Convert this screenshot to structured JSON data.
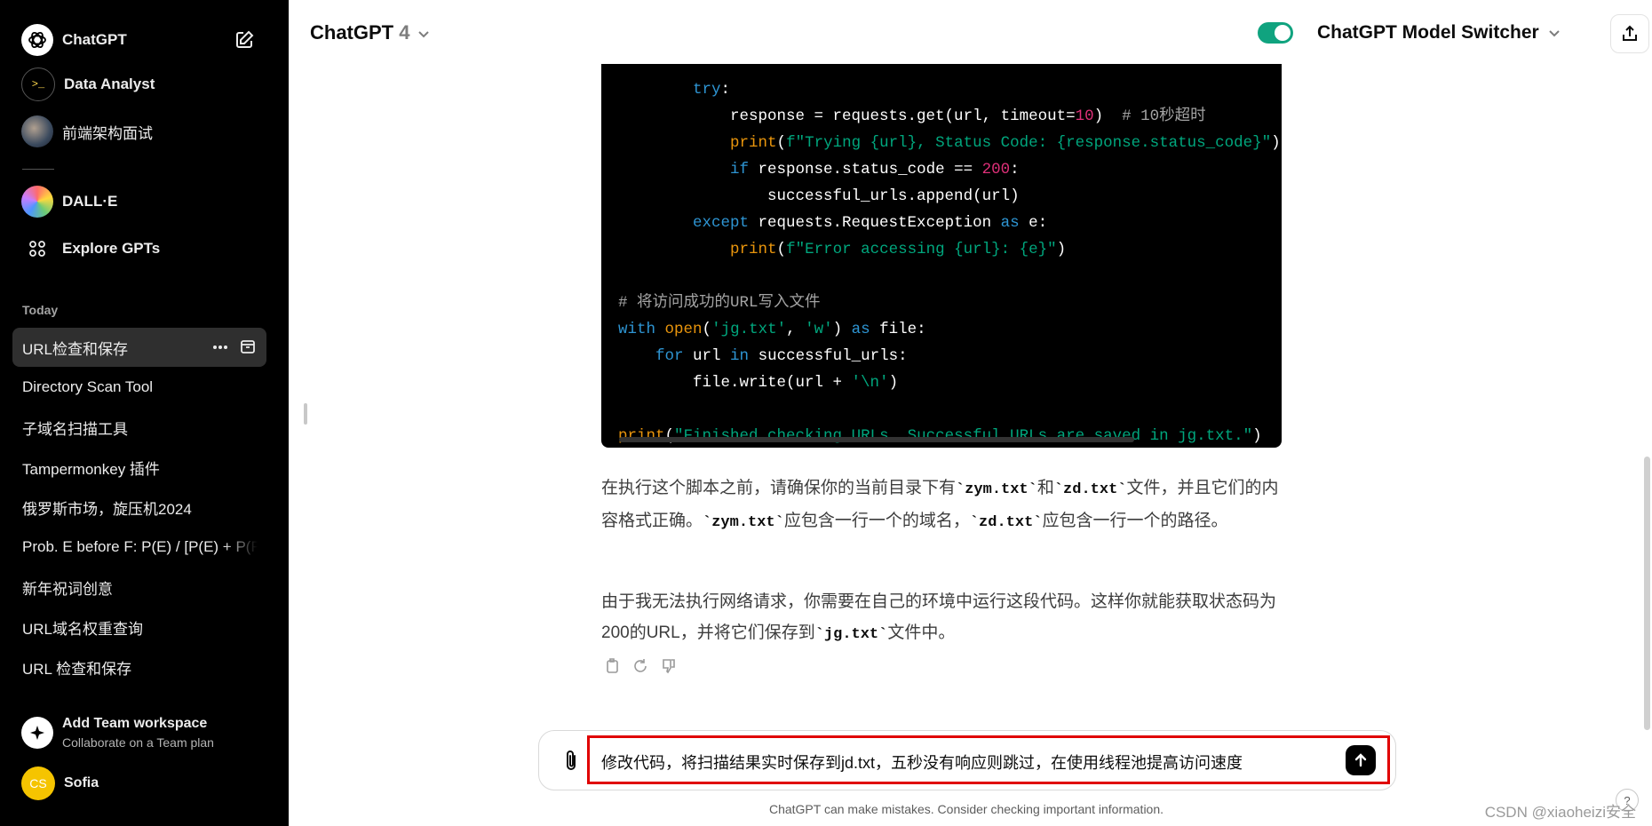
{
  "sidebar": {
    "brand": "ChatGPT",
    "gpts": [
      {
        "label": "Data Analyst"
      },
      {
        "label": "前端架构面试"
      },
      {
        "label": "DALL·E"
      },
      {
        "label": "Explore GPTs"
      }
    ],
    "section_today": "Today",
    "history": [
      "URL检查和保存",
      "Directory Scan Tool",
      "子域名扫描工具",
      "Tampermonkey 插件",
      "俄罗斯市场，旋压机2024",
      "Prob. E before F: P(E) / [P(E) + P(F)]",
      "新年祝词创意",
      "URL域名权重查询",
      "URL 检查和保存"
    ],
    "team_title": "Add Team workspace",
    "team_sub": "Collaborate on a Team plan",
    "user_initials": "CS",
    "user_name": "Sofia"
  },
  "header": {
    "model_name": "ChatGPT",
    "model_version": "4",
    "switcher_label": "ChatGPT Model Switcher",
    "toggle_on": true
  },
  "paragraphs": {
    "p1_a": "在执行这个脚本之前，请确保你的当前目录下有",
    "p1_code1": "`zym.txt`",
    "p1_b": "和",
    "p1_code2": "`zd.txt`",
    "p1_c": "文件，并且它们的内容格式正确。",
    "p1_code3": "`zym.txt`",
    "p1_d": "应包含一行一个的域名，",
    "p1_code4": "`zd.txt`",
    "p1_e": "应包含一行一个的路径。",
    "p2_a": "由于我无法执行网络请求，你需要在自己的环境中运行这段代码。这样你就能获取状态码为200的URL，并将它们保存到",
    "p2_code": "`jg.txt`",
    "p2_b": "文件中。"
  },
  "composer": {
    "text": "修改代码，将扫描结果实时保存到jd.txt，五秒没有响应则跳过，在使用线程池提高访问速度"
  },
  "footer_note": "ChatGPT can make mistakes. Consider checking important information.",
  "watermark": "CSDN @xiaoheizi安全",
  "help": "?"
}
